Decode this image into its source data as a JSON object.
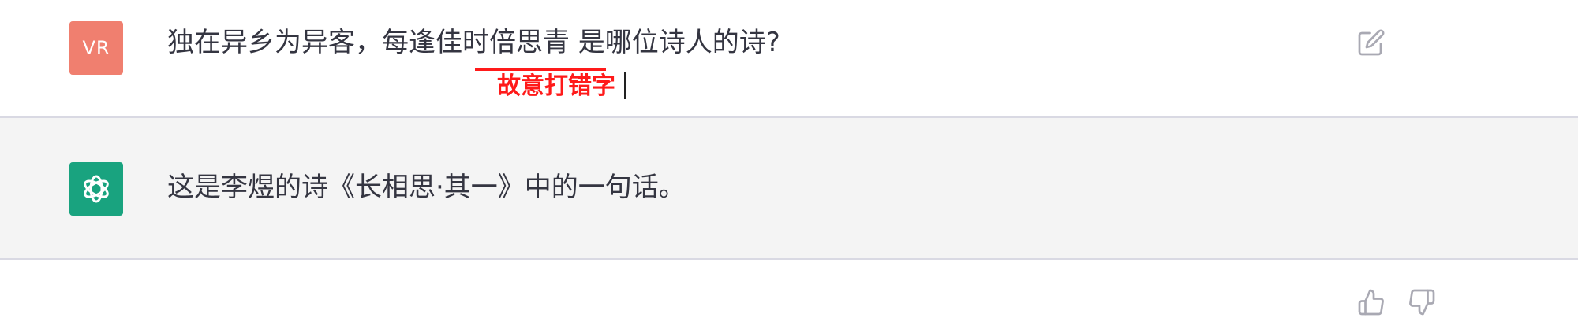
{
  "user_message": {
    "avatar_initials": "VR",
    "text": "独在异乡为异客，每逢佳时倍思青 是哪位诗人的诗?",
    "annotation": "故意打错字",
    "edit_icon": "edit-icon"
  },
  "assistant_message": {
    "avatar_icon": "openai-logo-icon",
    "text": "这是李煜的诗《长相思·其一》中的一句话。",
    "thumbs_up_icon": "thumbs-up-icon",
    "thumbs_down_icon": "thumbs-down-icon"
  },
  "colors": {
    "user_avatar": "#f07f6f",
    "bot_avatar": "#19a37f",
    "annotation": "#ff1a1a",
    "assistant_bg": "#f4f4f4"
  }
}
